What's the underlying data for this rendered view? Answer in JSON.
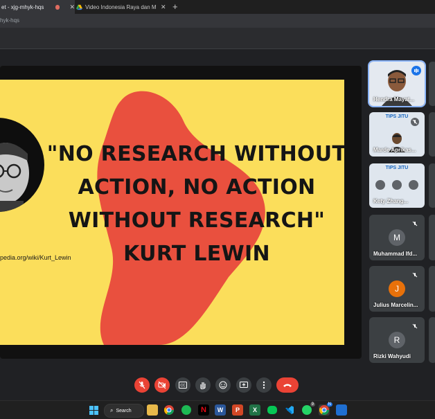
{
  "browser": {
    "tabs": [
      {
        "label": "et - xjg-mhyk-hqs",
        "recording": true
      },
      {
        "label": "Video Indonesia Raya dan Mars I"
      }
    ],
    "url": "hyk-hqs"
  },
  "slide": {
    "quote_lines": [
      "\"NO RESEARCH WITHOUT",
      "ACTION, NO ACTION",
      "WITHOUT RESEARCH\"",
      "KURT LEWIN"
    ],
    "caption": "pedia.org/wiki/Kurt_Lewin",
    "colors": {
      "background": "#fbde5b",
      "blob": "#e9503e"
    }
  },
  "participants": [
    {
      "name": "Hendra Mayat...",
      "type": "video",
      "speaking": true
    },
    {
      "name": "Marde Aprikas...",
      "type": "video",
      "poster": "TIPS JITU"
    },
    {
      "name": "Kety Zhang...",
      "type": "video",
      "poster": "TIPS JITU"
    },
    {
      "name": "Muhammad Ifd...",
      "initial": "M",
      "avatar_color": "#5f6368"
    },
    {
      "name": "Julius Marcelin...",
      "initial": "J",
      "avatar_color": "#e8710a"
    },
    {
      "name": "Rizki Wahyudi",
      "initial": "R",
      "avatar_color": "#5f6368"
    }
  ],
  "controls": [
    "mic-off",
    "camera-off",
    "captions",
    "raise-hand",
    "emoji",
    "present",
    "more",
    "leave-call"
  ],
  "taskbar": {
    "search_label": "Search",
    "badges": {
      "whatsapp": "9",
      "chrome": "N"
    }
  }
}
